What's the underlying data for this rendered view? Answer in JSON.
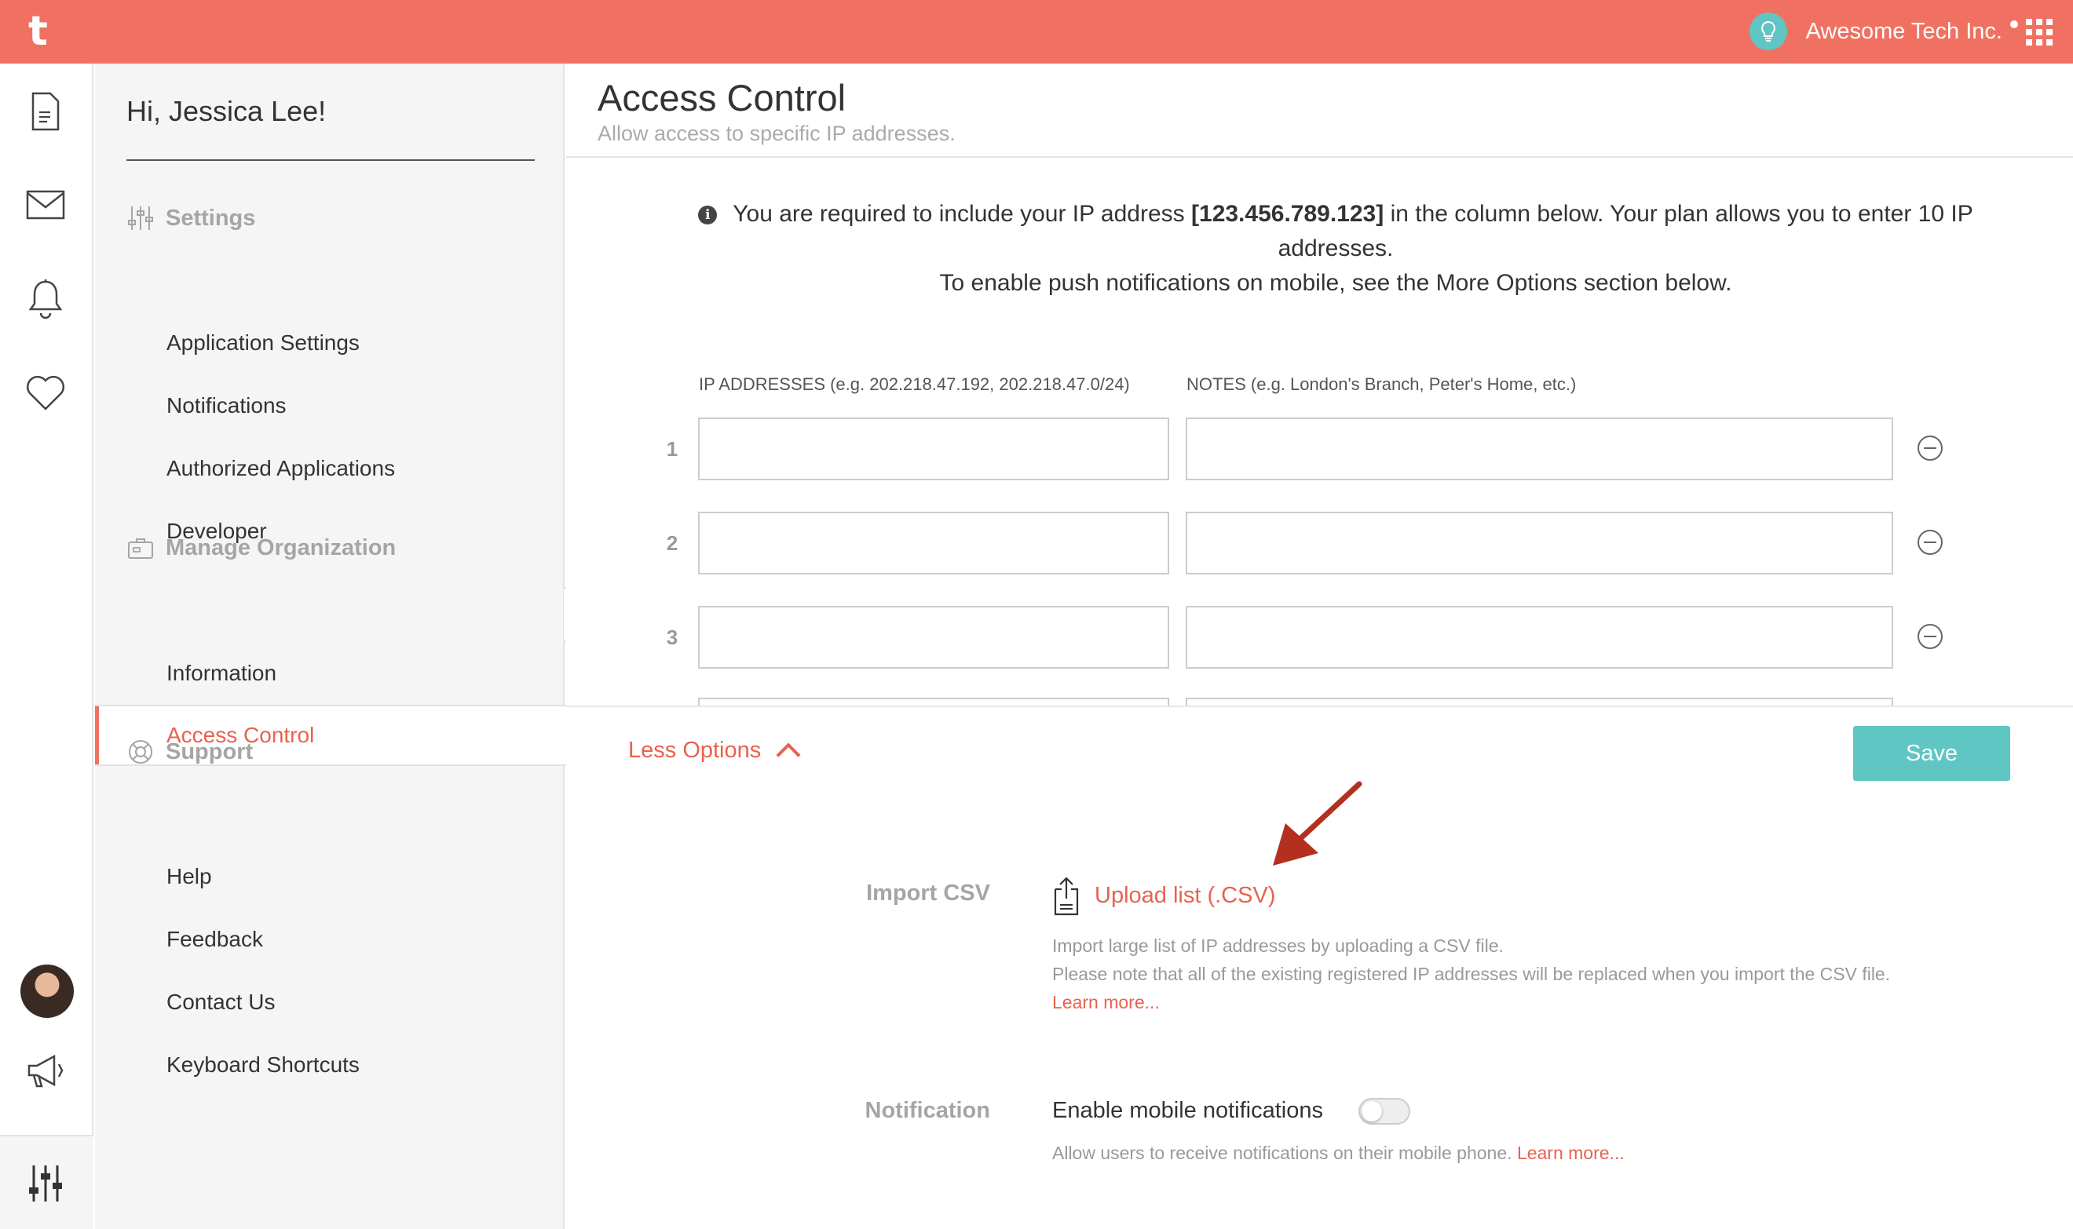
{
  "app": {
    "logo": "t",
    "org_name": "Awesome Tech Inc.",
    "accent_color": "#f07162",
    "action_color": "#5fc6c4"
  },
  "rail": {
    "icons": [
      "document-icon",
      "mail-icon",
      "bell-icon",
      "heart-icon",
      "megaphone-icon",
      "sliders-icon"
    ]
  },
  "sidebar": {
    "greeting": "Hi, Jessica Lee!",
    "sections": [
      {
        "title": "Settings",
        "icon": "sliders-icon",
        "items": [
          "Application Settings",
          "Notifications",
          "Authorized Applications",
          "Developer"
        ]
      },
      {
        "title": "Manage Organization",
        "icon": "briefcase-icon",
        "items": [
          "Information",
          "Access Control"
        ]
      },
      {
        "title": "Support",
        "icon": "lifebuoy-icon",
        "items": [
          "Help",
          "Feedback",
          "Contact Us",
          "Keyboard Shortcuts"
        ]
      }
    ],
    "active_item": "Access Control"
  },
  "main": {
    "title": "Access Control",
    "subtitle": "Allow access to specific IP addresses.",
    "info": {
      "prefix": "You are required to include your IP address",
      "ip": "[123.456.789.123]",
      "suffix": "in the column below. Your plan allows you to enter 10 IP addresses.",
      "line2": "To enable push notifications on mobile, see the More Options section below."
    },
    "table": {
      "ip_header": "IP ADDRESSES (e.g. 202.218.47.192, 202.218.47.0/24)",
      "notes_header": "NOTES (e.g. London's Branch, Peter's Home, etc.)",
      "rows": [
        {
          "num": "1",
          "ip": "",
          "note": ""
        },
        {
          "num": "2",
          "ip": "",
          "note": ""
        },
        {
          "num": "3",
          "ip": "",
          "note": ""
        }
      ]
    },
    "less_options": "Less Options",
    "save_label": "Save",
    "import": {
      "label": "Import CSV",
      "upload_label": "Upload list (.CSV)",
      "hint1": "Import large list of IP addresses by uploading a CSV file.",
      "hint2": "Please note that all of the existing registered IP addresses will be replaced when you import the CSV file.",
      "learn_more": "Learn more..."
    },
    "notification": {
      "label": "Notification",
      "title": "Enable mobile notifications",
      "hint": "Allow users to receive notifications on their mobile phone.",
      "learn_more": "Learn more...",
      "enabled": false
    }
  }
}
